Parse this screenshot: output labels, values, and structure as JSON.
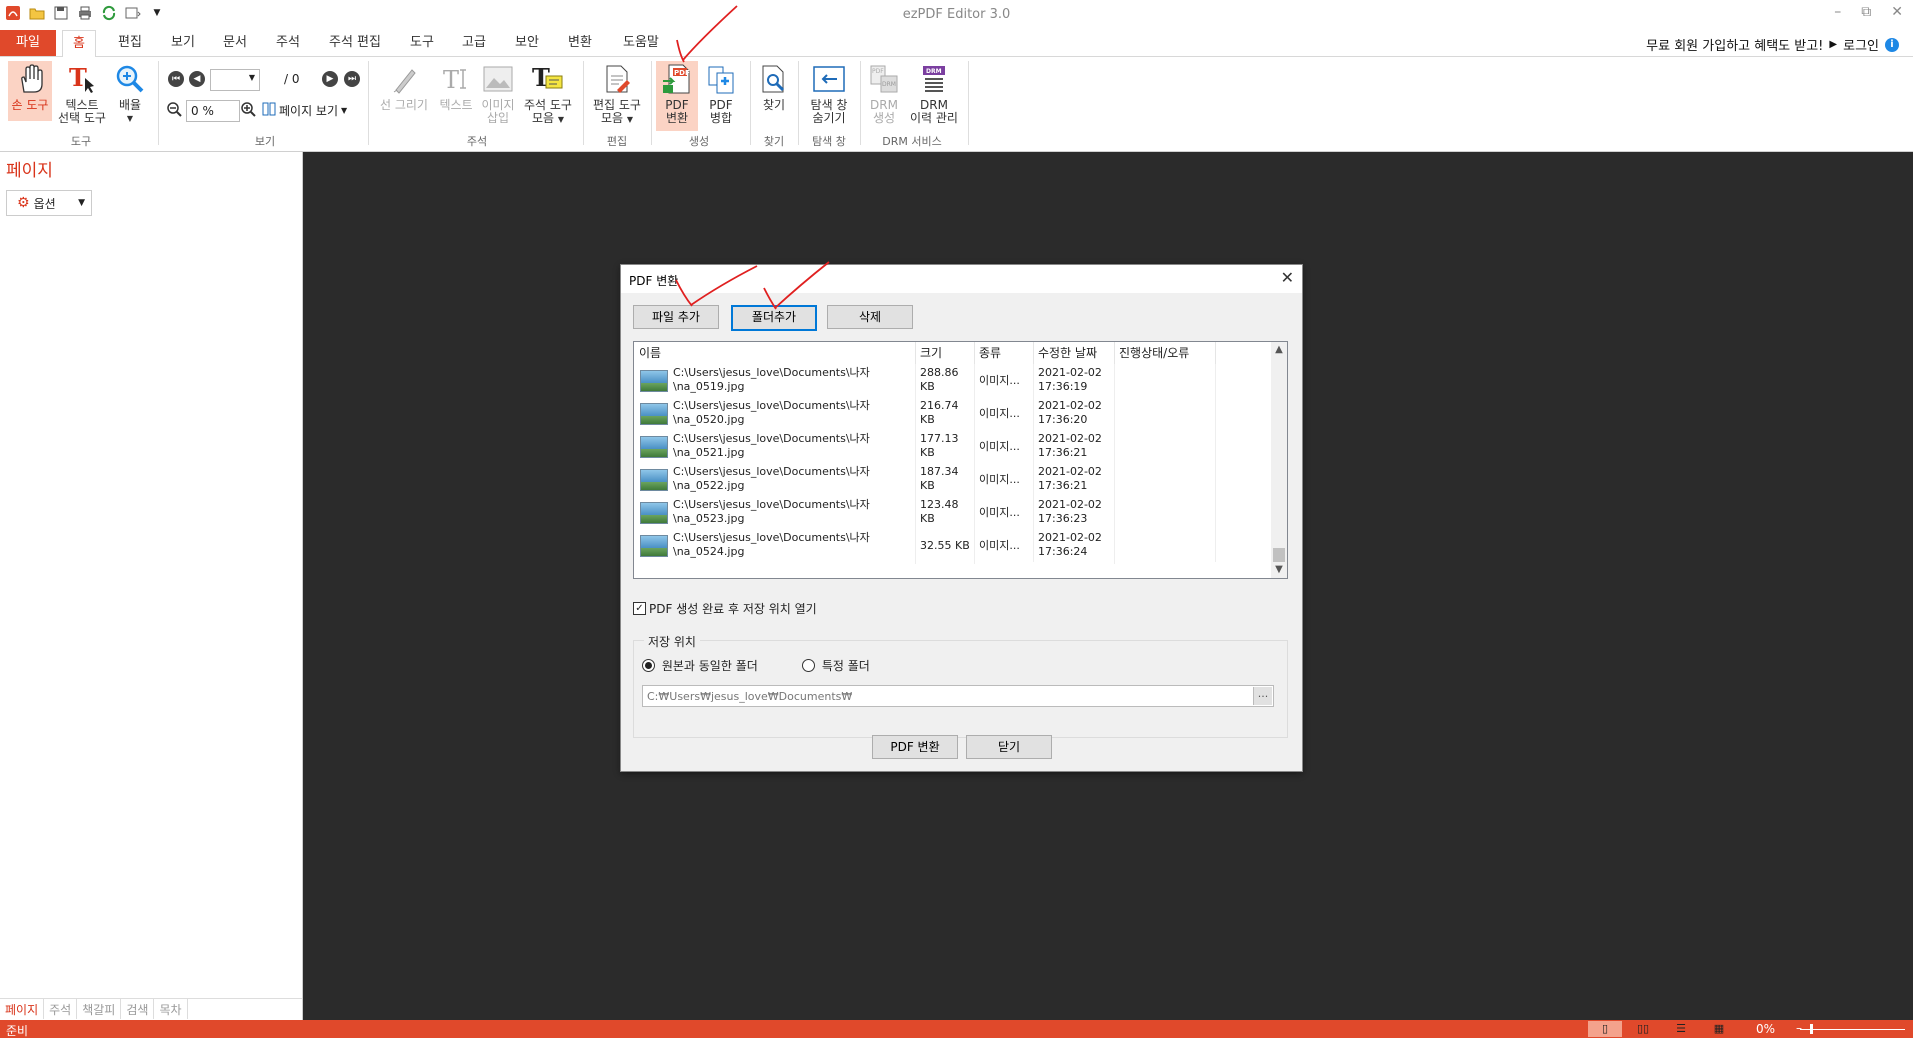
{
  "window": {
    "title": "ezPDF Editor 3.0",
    "controls": [
      "–",
      "⧉",
      "✕"
    ]
  },
  "menu": {
    "file": "파일",
    "tabs": [
      "홈",
      "편집",
      "보기",
      "문서",
      "주석",
      "주석 편집",
      "도구",
      "고급",
      "보안",
      "변환",
      "도움말"
    ],
    "promo": "무료 회원 가입하고 혜택도 받고!",
    "login": "로그인",
    "promo_arrow": "▶"
  },
  "ribbon": {
    "hand_tool": "손 도구",
    "text_select_1": "텍스트",
    "text_select_2": "선택 도구",
    "zoom_1": "배율",
    "group_tool": "도구",
    "page_total": "/ 0",
    "zoom_value": "0 %",
    "page_view": "페이지 보기",
    "group_view": "보기",
    "line_draw": "선 그리기",
    "text": "텍스트",
    "image_insert_1": "이미지",
    "image_insert_2": "삽입",
    "annot_tools_1": "주석 도구",
    "annot_tools_2": "모음",
    "group_annot": "주석",
    "edit_tools_1": "편집 도구",
    "edit_tools_2": "모음",
    "group_edit": "편집",
    "pdf_convert_1": "PDF",
    "pdf_convert_2": "변환",
    "pdf_merge_1": "PDF",
    "pdf_merge_2": "병합",
    "group_create": "생성",
    "find": "찾기",
    "group_find": "찾기",
    "nav_hide_1": "탐색 창",
    "nav_hide_2": "숨기기",
    "group_nav": "탐색 창",
    "drm_create_1": "DRM",
    "drm_create_2": "생성",
    "drm_manage_1": "DRM",
    "drm_manage_2": "이력 관리",
    "group_drm": "DRM 서비스"
  },
  "left_panel": {
    "title": "페이지",
    "options": "옵션",
    "tabs": [
      "페이지",
      "주석",
      "책갈피",
      "검색",
      "목차"
    ]
  },
  "status": {
    "ready": "준비",
    "zoom": "0%"
  },
  "dialog": {
    "title": "PDF 변환",
    "add_file": "파일 추가",
    "add_folder": "폴더추가",
    "delete": "삭제",
    "columns": [
      "이름",
      "크기",
      "종류",
      "수정한 날짜",
      "진행상태/오류"
    ],
    "rows": [
      {
        "path1": "C:\\Users\\jesus_love\\Documents\\나자",
        "path2": "\\na_0519.jpg",
        "size1": "288.86",
        "size2": "KB",
        "type": "이미지...",
        "date1": "2021-02-02",
        "date2": "17:36:19"
      },
      {
        "path1": "C:\\Users\\jesus_love\\Documents\\나자",
        "path2": "\\na_0520.jpg",
        "size1": "216.74",
        "size2": "KB",
        "type": "이미지...",
        "date1": "2021-02-02",
        "date2": "17:36:20"
      },
      {
        "path1": "C:\\Users\\jesus_love\\Documents\\나자",
        "path2": "\\na_0521.jpg",
        "size1": "177.13",
        "size2": "KB",
        "type": "이미지...",
        "date1": "2021-02-02",
        "date2": "17:36:21"
      },
      {
        "path1": "C:\\Users\\jesus_love\\Documents\\나자",
        "path2": "\\na_0522.jpg",
        "size1": "187.34",
        "size2": "KB",
        "type": "이미지...",
        "date1": "2021-02-02",
        "date2": "17:36:21"
      },
      {
        "path1": "C:\\Users\\jesus_love\\Documents\\나자",
        "path2": "\\na_0523.jpg",
        "size1": "123.48",
        "size2": "KB",
        "type": "이미지...",
        "date1": "2021-02-02",
        "date2": "17:36:23"
      },
      {
        "path1": "C:\\Users\\jesus_love\\Documents\\나자",
        "path2": "\\na_0524.jpg",
        "size1": "32.55 KB",
        "size2": "",
        "type": "이미지...",
        "date1": "2021-02-02",
        "date2": "17:36:24"
      }
    ],
    "open_after": "PDF 생성 완료 후 저장 위치 열기",
    "open_after_checked": true,
    "save_location": "저장 위치",
    "same_folder": "원본과 동일한 폴더",
    "specific_folder": "특정 폴더",
    "path": "C:₩Users₩jesus_love₩Documents₩",
    "browse": "...",
    "convert": "PDF 변환",
    "close": "닫기"
  },
  "colors": {
    "accent": "#e0492b",
    "annotation": "#e02020"
  }
}
